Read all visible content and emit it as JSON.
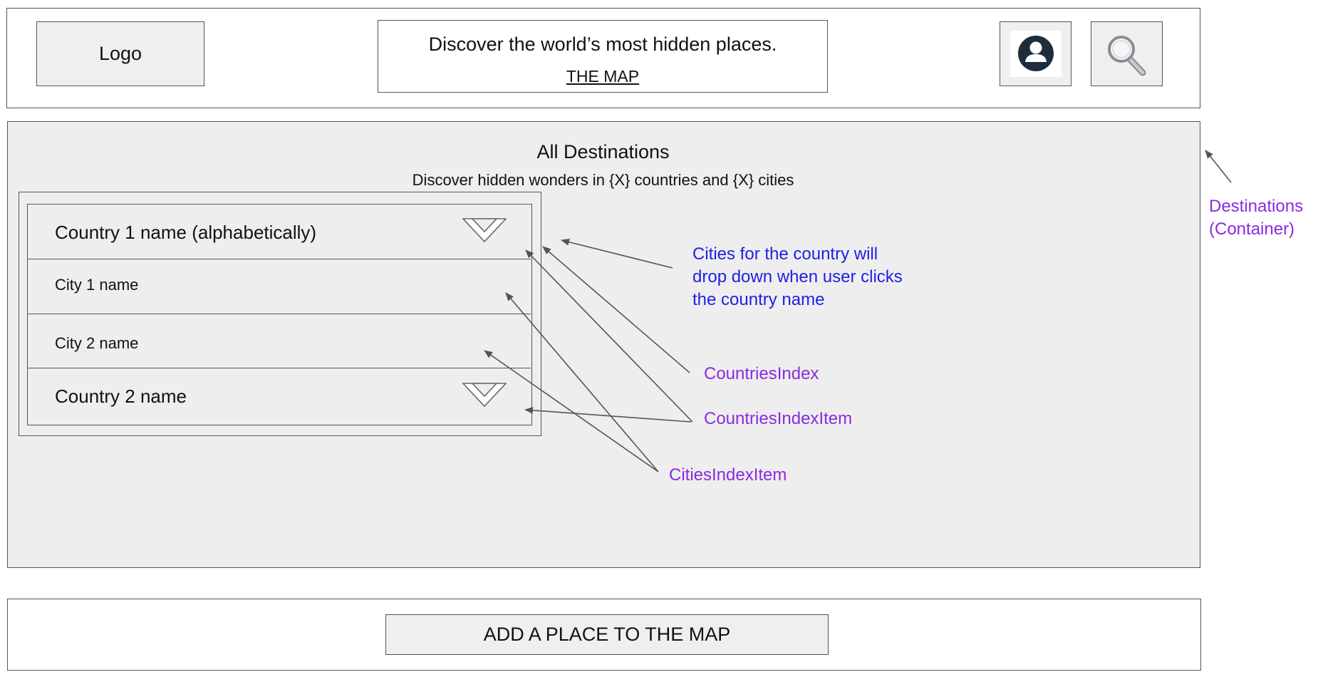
{
  "header": {
    "logo_label": "Logo",
    "tagline": "Discover the world’s most hidden places.",
    "map_link": "THE MAP",
    "profile_icon": "user-icon",
    "search_icon": "search-icon"
  },
  "destinations": {
    "title": "All Destinations",
    "subtitle": "Discover hidden wonders in {X} countries and {X} cities",
    "rows": [
      {
        "kind": "country",
        "label": "Country 1 name (alphabetically)",
        "icon": "chevron-down-icon"
      },
      {
        "kind": "city",
        "label": "City 1 name"
      },
      {
        "kind": "city",
        "label": "City 2 name"
      },
      {
        "kind": "country",
        "label": "Country 2 name",
        "icon": "chevron-down-icon"
      }
    ]
  },
  "annotations": {
    "note_line1": "Cities for the country will",
    "note_line2": "drop down when user clicks",
    "note_line3": "the country name",
    "countries_index": "CountriesIndex",
    "countries_index_item": "CountriesIndexItem",
    "cities_index_item": "CitiesIndexItem",
    "container_line1": "Destinations",
    "container_line2": "(Container)"
  },
  "footer": {
    "add_button": "ADD A PLACE TO THE MAP"
  },
  "colors": {
    "annotation_purple": "#8a2be2",
    "annotation_blue": "#1f1fe6",
    "panel_gray": "#eeeeee",
    "border_gray": "#555555",
    "avatar_dark": "#1e2d3b"
  }
}
